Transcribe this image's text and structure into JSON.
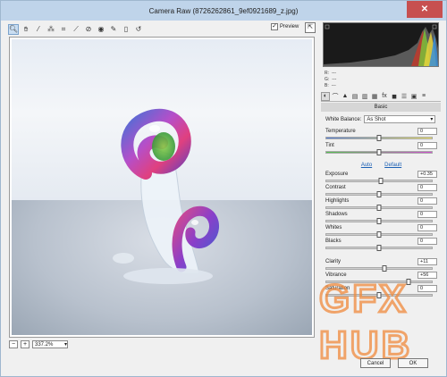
{
  "window": {
    "title": "Camera Raw (8726262861_9ef0921689_z.jpg)",
    "close_label": "✕"
  },
  "toolbar": {
    "tools": [
      "zoom-icon",
      "hand-icon",
      "eyedropper-icon",
      "color-sampler-icon",
      "crop-icon",
      "straighten-icon",
      "spot-removal-icon",
      "red-eye-icon",
      "adjustment-brush-icon",
      "graduated-filter-icon"
    ],
    "preview_label": "Preview",
    "preview_checked": "✓"
  },
  "rgb": {
    "r_label": "R:",
    "g_label": "G:",
    "b_label": "B:",
    "r_value": "---",
    "g_value": "---",
    "b_value": "---"
  },
  "panel": {
    "title": "Basic"
  },
  "white_balance": {
    "label": "White Balance:",
    "value": "As Shot"
  },
  "sliders": {
    "temperature": {
      "label": "Temperature",
      "value": "0"
    },
    "tint": {
      "label": "Tint",
      "value": "0"
    },
    "exposure": {
      "label": "Exposure",
      "value": "+0.35"
    },
    "contrast": {
      "label": "Contrast",
      "value": "0"
    },
    "highlights": {
      "label": "Highlights",
      "value": "0"
    },
    "shadows": {
      "label": "Shadows",
      "value": "0"
    },
    "whites": {
      "label": "Whites",
      "value": "0"
    },
    "blacks": {
      "label": "Blacks",
      "value": "0"
    },
    "clarity": {
      "label": "Clarity",
      "value": "+11"
    },
    "vibrance": {
      "label": "Vibrance",
      "value": "+56"
    },
    "saturation": {
      "label": "Saturation",
      "value": "0"
    }
  },
  "auto_default": {
    "auto": "Auto",
    "default": "Default"
  },
  "zoom": {
    "minus": "−",
    "plus": "+",
    "value": "337.2%",
    "arrow": "▾"
  },
  "buttons": {
    "cancel": "Cancel",
    "ok": "OK"
  },
  "watermark": {
    "text": "GFX HUB"
  },
  "colors": {
    "accent": "#1a5fb4",
    "title_bar": "#bfd4ea",
    "watermark": "#f08a3c"
  }
}
